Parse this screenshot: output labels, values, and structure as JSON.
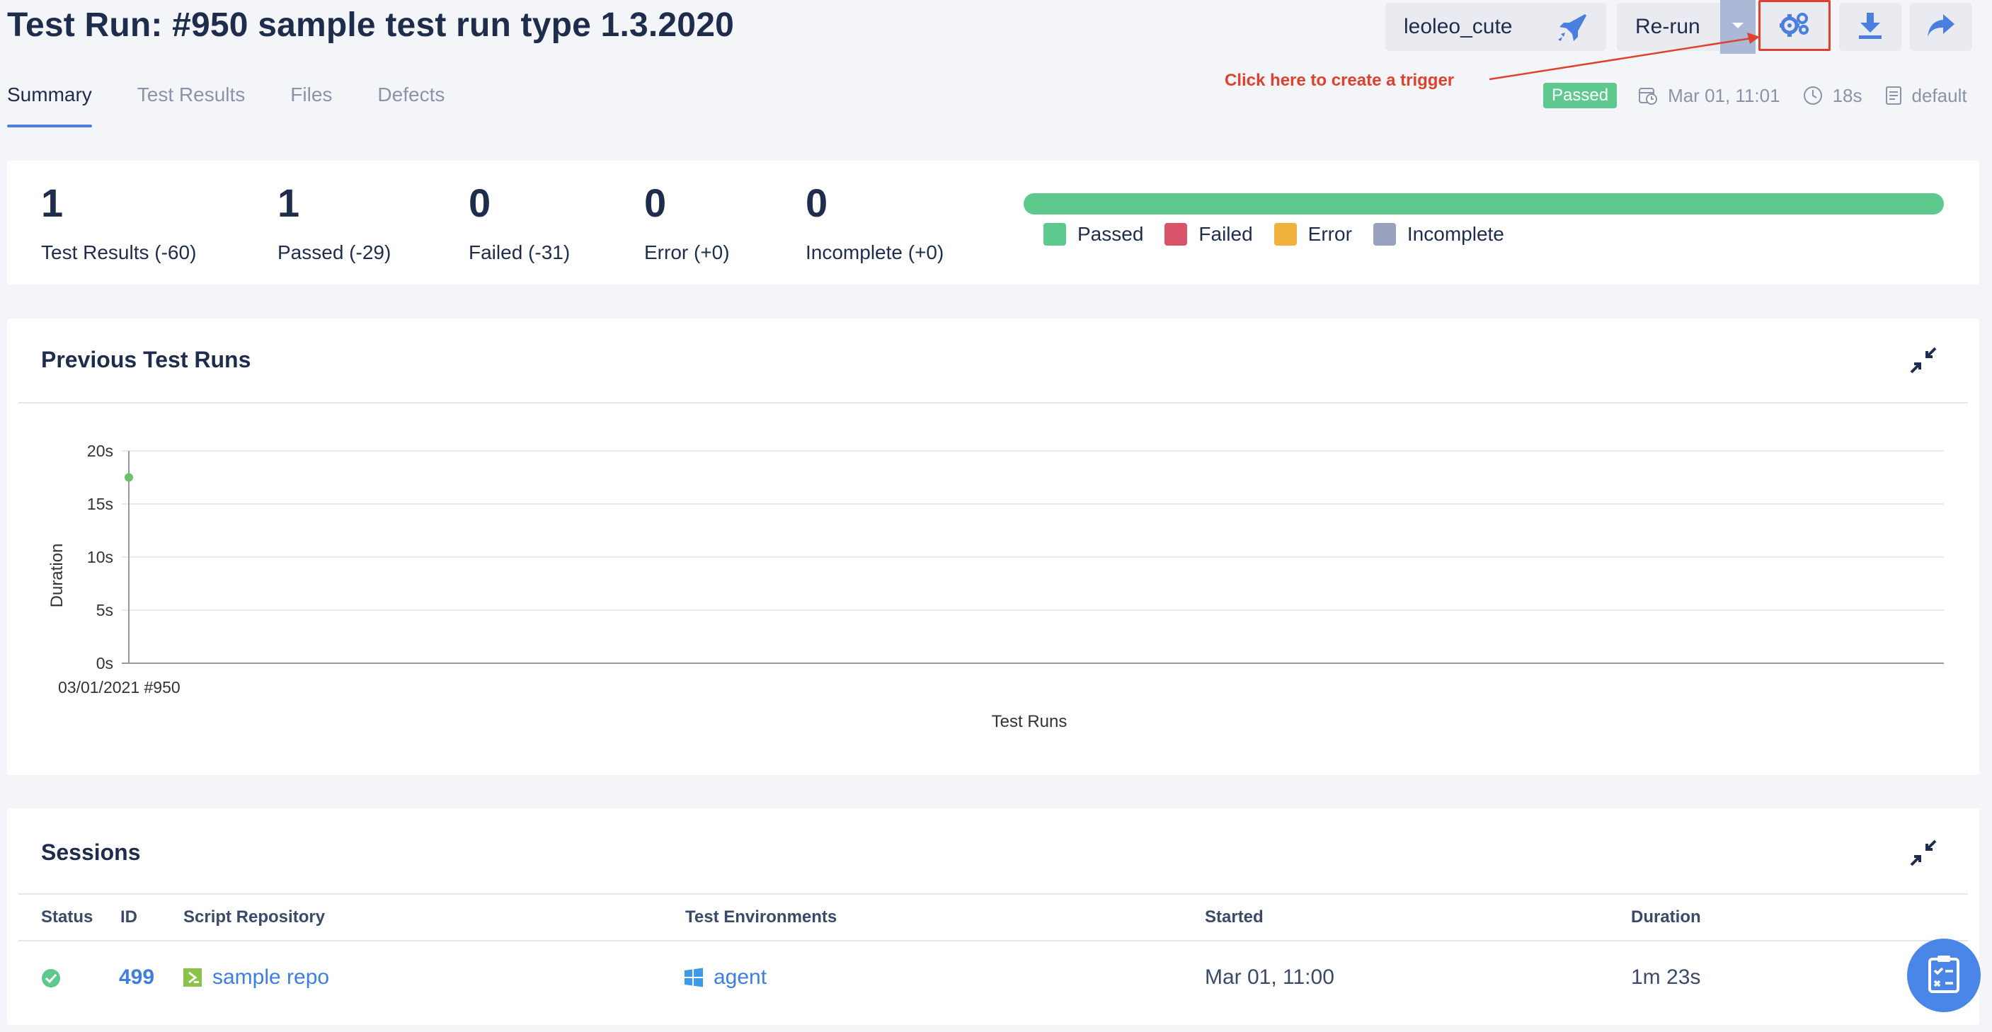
{
  "header": {
    "title": "Test Run: #950 sample test run type 1.3.2020",
    "user_label": "leoleo_cute",
    "rerun_label": "Re-run",
    "annotation": "Click here to create a trigger"
  },
  "tabs": [
    {
      "label": "Summary",
      "active": true
    },
    {
      "label": "Test Results",
      "active": false
    },
    {
      "label": "Files",
      "active": false
    },
    {
      "label": "Defects",
      "active": false
    }
  ],
  "meta": {
    "status": "Passed",
    "date": "Mar 01, 11:01",
    "duration": "18s",
    "environment": "default"
  },
  "summary": {
    "stats": [
      {
        "value": "1",
        "label": "Test Results (-60)"
      },
      {
        "value": "1",
        "label": "Passed (-29)"
      },
      {
        "value": "0",
        "label": "Failed (-31)"
      },
      {
        "value": "0",
        "label": "Error (+0)"
      },
      {
        "value": "0",
        "label": "Incomplete (+0)"
      }
    ],
    "legend": [
      {
        "label": "Passed",
        "color": "#5ec98f"
      },
      {
        "label": "Failed",
        "color": "#d9546a"
      },
      {
        "label": "Error",
        "color": "#f0b23c"
      },
      {
        "label": "Incomplete",
        "color": "#98a2bf"
      }
    ],
    "progress_passed_fraction": 1.0
  },
  "chart_card": {
    "title": "Previous Test Runs"
  },
  "chart_data": {
    "type": "scatter",
    "title": "",
    "xlabel": "Test Runs",
    "ylabel": "Duration",
    "y_ticks": [
      "0s",
      "5s",
      "10s",
      "15s",
      "20s"
    ],
    "ylim": [
      0,
      20
    ],
    "categories": [
      "03/01/2021 #950"
    ],
    "values": [
      17.5
    ],
    "point_color": "#6cc06a",
    "grid": true
  },
  "sessions": {
    "title": "Sessions",
    "columns": [
      "Status",
      "ID",
      "Script Repository",
      "Test Environments",
      "Started",
      "Duration"
    ],
    "rows": [
      {
        "status": "passed",
        "id": "499",
        "repository": "sample repo",
        "environment": "agent",
        "started": "Mar 01, 11:00",
        "duration": "1m 23s"
      }
    ]
  },
  "colors": {
    "accent": "#4a7fe0",
    "passed": "#5ec98f",
    "annotation": "#e0402e"
  }
}
